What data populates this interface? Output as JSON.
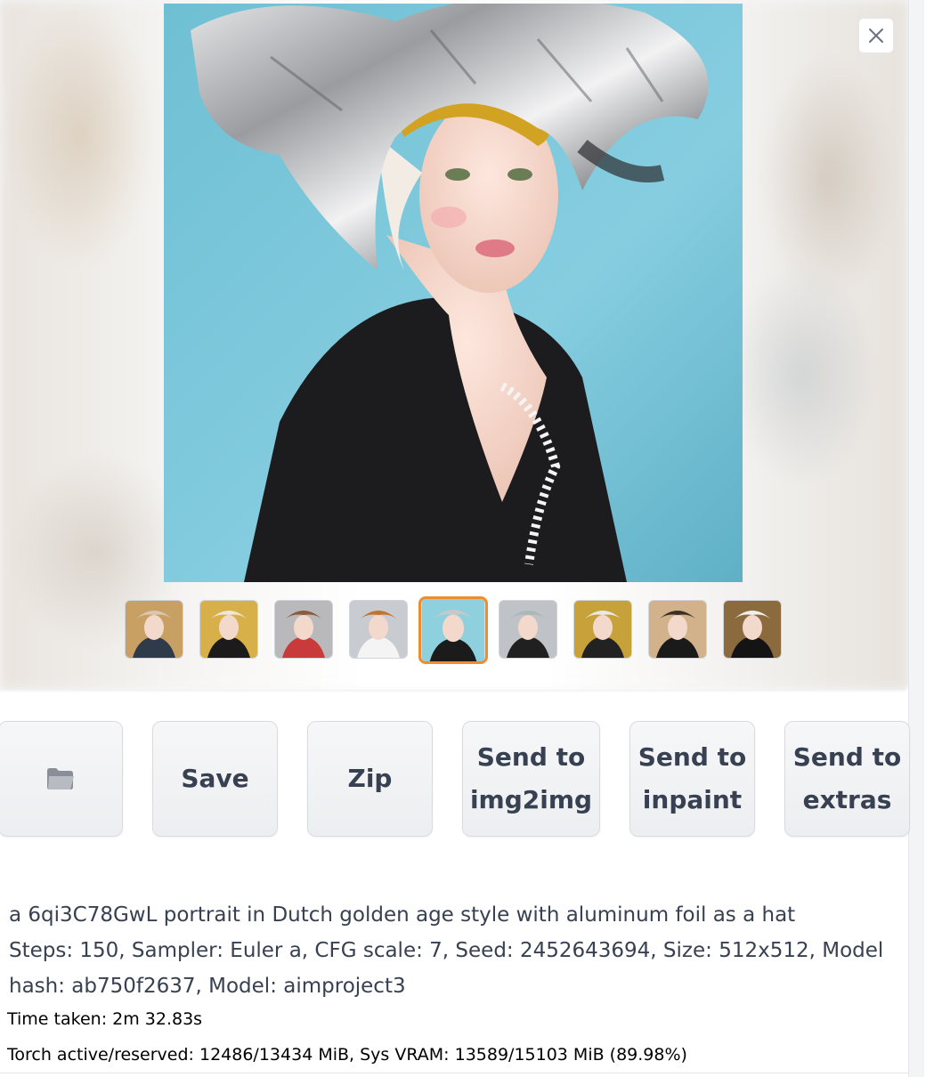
{
  "gallery": {
    "close_icon": "close-icon",
    "selected_index": 4,
    "thumbnails": [
      {
        "name": "grid-preview",
        "palette": [
          "#c9a064",
          "#2f3b4a",
          "#d8c8b0"
        ]
      },
      {
        "name": "portrait-gold-hat",
        "palette": [
          "#d8b04a",
          "#1c1a1a",
          "#efe6da"
        ]
      },
      {
        "name": "portrait-foil-red-shirt",
        "palette": [
          "#b9b9bb",
          "#c93a3a",
          "#8a5b3c"
        ]
      },
      {
        "name": "portrait-foil-ruff",
        "palette": [
          "#c8cbd0",
          "#f4f4f4",
          "#c4732d"
        ]
      },
      {
        "name": "portrait-foil-blue",
        "palette": [
          "#8fd0df",
          "#1b1b1b",
          "#c8c8c8"
        ]
      },
      {
        "name": "portrait-foil-dark",
        "palette": [
          "#bfc2c6",
          "#202020",
          "#a9b7b9"
        ]
      },
      {
        "name": "portrait-gold-top-hat",
        "palette": [
          "#c7a23a",
          "#222",
          "#e8e8e8"
        ]
      },
      {
        "name": "portrait-framed-dark",
        "palette": [
          "#d1b28a",
          "#1a1a1a",
          "#3c3024"
        ]
      },
      {
        "name": "portrait-gold-frame",
        "palette": [
          "#8b6b3e",
          "#141414",
          "#f0efe9"
        ]
      }
    ]
  },
  "actions": {
    "folder_icon": "folder-icon",
    "save_label": "Save",
    "zip_label": "Zip",
    "send_img2img_label": "Send to\nimg2img",
    "send_inpaint_label": "Send to\ninpaint",
    "send_extras_label": "Send to\nextras"
  },
  "info": {
    "prompt": "a 6qi3C78GwL portrait in Dutch golden age style with aluminum foil as a hat",
    "params_line1": "Steps: 150, Sampler: Euler a, CFG scale: 7, Seed: 2452643694, Size: 512x512, Model",
    "params_line2": "hash: ab750f2637, Model: aimproject3",
    "time_taken": "Time taken: 2m 32.83s",
    "vram": "Torch active/reserved: 12486/13434 MiB, Sys VRAM: 13589/15103 MiB (89.98%)"
  },
  "colors": {
    "accent_selected": "#f08c2c",
    "text": "#374151",
    "portrait_bg": "#7fc2d4"
  }
}
